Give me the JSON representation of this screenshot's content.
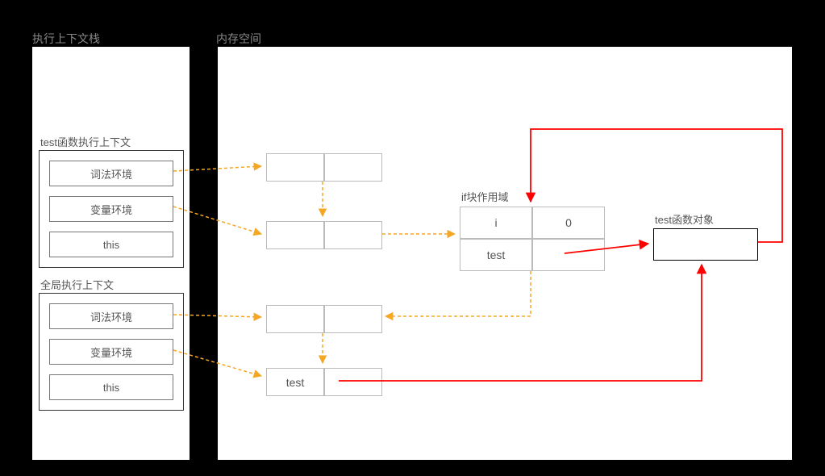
{
  "labels": {
    "stack_title": "执行上下文栈",
    "memory_title": "内存空间",
    "test_ctx_title": "test函数执行上下文",
    "global_ctx_title": "全局执行上下文",
    "lexical_env": "词法环境",
    "variable_env": "变量环境",
    "this_binding": "this",
    "if_block_title": "if块作用域",
    "test_fn_obj_title": "test函数对象"
  },
  "if_block": {
    "row1_key": "i",
    "row1_val": "0",
    "row2_key": "test",
    "row2_val": ""
  },
  "global_mem": {
    "test_key": "test"
  },
  "colors": {
    "orange": "#f5a623",
    "red": "#ff0000"
  }
}
